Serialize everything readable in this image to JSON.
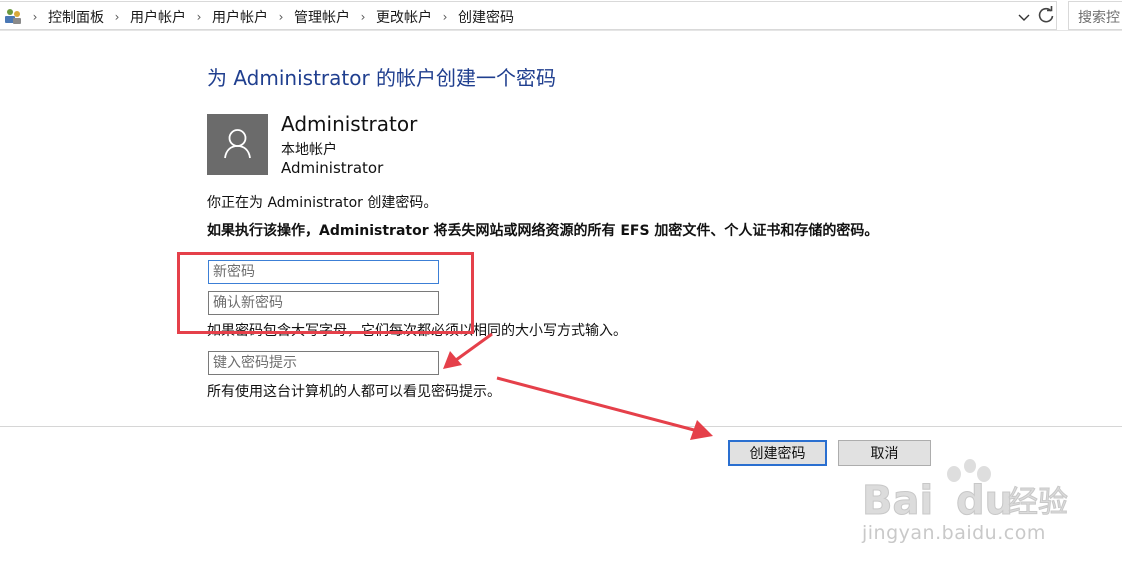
{
  "address_bar": {
    "crumbs": [
      "控制面板",
      "用户帐户",
      "用户帐户",
      "管理帐户",
      "更改帐户",
      "创建密码"
    ],
    "search_placeholder": "搜索控"
  },
  "page": {
    "title": "为 Administrator 的帐户创建一个密码",
    "account": {
      "name": "Administrator",
      "type": "本地帐户",
      "group": "Administrator"
    },
    "info_text": "你正在为 Administrator 创建密码。",
    "warning_text": "如果执行该操作，Administrator 将丢失网站或网络资源的所有 EFS 加密文件、个人证书和存储的密码。",
    "new_password_placeholder": "新密码",
    "confirm_password_placeholder": "确认新密码",
    "case_note": "如果密码包含大写字母，它们每次都必须以相同的大小写方式输入。",
    "hint_placeholder": "键入密码提示",
    "hint_note": "所有使用这台计算机的人都可以看见密码提示。",
    "create_button": "创建密码",
    "cancel_button": "取消"
  },
  "watermark": {
    "url": "jingyan.baidu.com"
  },
  "colors": {
    "title": "#203f8f",
    "avatar_bg": "#6b6b6b",
    "annotation": "#e5404a",
    "focus_border": "#3c7fd6"
  }
}
